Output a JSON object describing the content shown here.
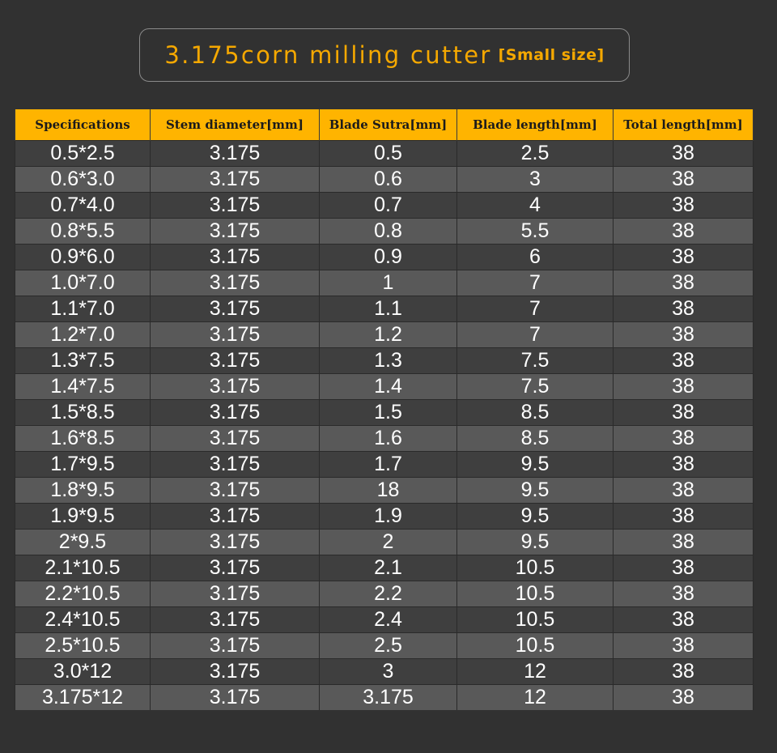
{
  "title": {
    "main": "3.175corn milling cutter",
    "sub": "[Small size]"
  },
  "colors": {
    "background": "#313131",
    "accent": "#f5a800",
    "header_bg": "#ffb400"
  },
  "table": {
    "headers": [
      "Specifications",
      "Stem diameter[mm]",
      "Blade Sutra[mm]",
      "Blade length[mm]",
      "Total length[mm]"
    ],
    "rows": [
      [
        "0.5*2.5",
        "3.175",
        "0.5",
        "2.5",
        "38"
      ],
      [
        "0.6*3.0",
        "3.175",
        "0.6",
        "3",
        "38"
      ],
      [
        "0.7*4.0",
        "3.175",
        "0.7",
        "4",
        "38"
      ],
      [
        "0.8*5.5",
        "3.175",
        "0.8",
        "5.5",
        "38"
      ],
      [
        "0.9*6.0",
        "3.175",
        "0.9",
        "6",
        "38"
      ],
      [
        "1.0*7.0",
        "3.175",
        "1",
        "7",
        "38"
      ],
      [
        "1.1*7.0",
        "3.175",
        "1.1",
        "7",
        "38"
      ],
      [
        "1.2*7.0",
        "3.175",
        "1.2",
        "7",
        "38"
      ],
      [
        "1.3*7.5",
        "3.175",
        "1.3",
        "7.5",
        "38"
      ],
      [
        "1.4*7.5",
        "3.175",
        "1.4",
        "7.5",
        "38"
      ],
      [
        "1.5*8.5",
        "3.175",
        "1.5",
        "8.5",
        "38"
      ],
      [
        "1.6*8.5",
        "3.175",
        "1.6",
        "8.5",
        "38"
      ],
      [
        "1.7*9.5",
        "3.175",
        "1.7",
        "9.5",
        "38"
      ],
      [
        "1.8*9.5",
        "3.175",
        "18",
        "9.5",
        "38"
      ],
      [
        "1.9*9.5",
        "3.175",
        "1.9",
        "9.5",
        "38"
      ],
      [
        "2*9.5",
        "3.175",
        "2",
        "9.5",
        "38"
      ],
      [
        "2.1*10.5",
        "3.175",
        "2.1",
        "10.5",
        "38"
      ],
      [
        "2.2*10.5",
        "3.175",
        "2.2",
        "10.5",
        "38"
      ],
      [
        "2.4*10.5",
        "3.175",
        "2.4",
        "10.5",
        "38"
      ],
      [
        "2.5*10.5",
        "3.175",
        "2.5",
        "10.5",
        "38"
      ],
      [
        "3.0*12",
        "3.175",
        "3",
        "12",
        "38"
      ],
      [
        "3.175*12",
        "3.175",
        "3.175",
        "12",
        "38"
      ]
    ]
  }
}
